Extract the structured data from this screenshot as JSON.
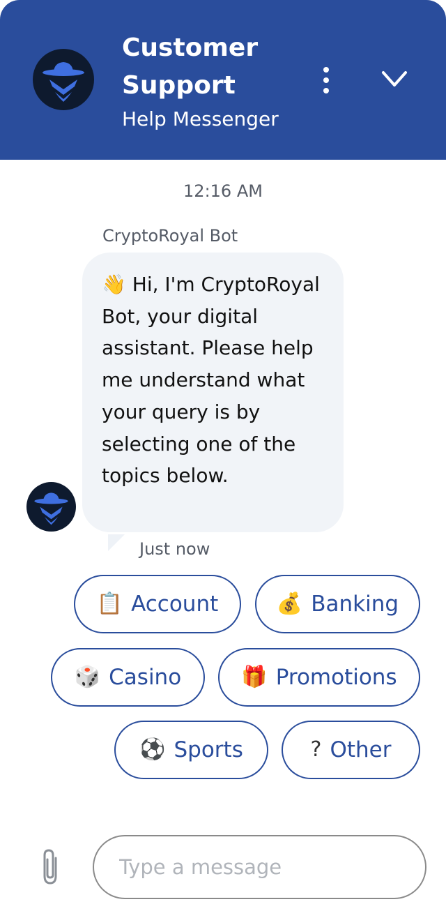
{
  "header": {
    "title": "Customer Support",
    "subtitle": "Help Messenger",
    "colors": {
      "background": "#2a4d9c",
      "text": "#ffffff"
    }
  },
  "conversation": {
    "timestamp": "12:16 AM",
    "sender": "CryptoRoyal Bot",
    "message": {
      "emoji": "👋",
      "text": " Hi, I'm CryptoRoyal Bot, your digital assistant. Please help me understand what your query is by selecting one of the topics below."
    },
    "time": "Just now"
  },
  "topics": [
    {
      "emoji": "📋",
      "label": "Account"
    },
    {
      "emoji": "💰",
      "label": "Banking"
    },
    {
      "emoji": "🎲",
      "label": "Casino"
    },
    {
      "emoji": "🎁",
      "label": "Promotions"
    },
    {
      "emoji": "⚽",
      "label": "Sports"
    },
    {
      "emoji": "?",
      "label": "Other"
    }
  ],
  "composer": {
    "placeholder": "Type a message"
  },
  "icons": {
    "avatar": "spy-bot-icon",
    "menu": "more-vertical-icon",
    "collapse": "chevron-down-icon",
    "attach": "paperclip-icon"
  },
  "colors": {
    "accent": "#2a4d9c",
    "bubble": "#f1f4f8",
    "muted_text": "#555b66"
  }
}
